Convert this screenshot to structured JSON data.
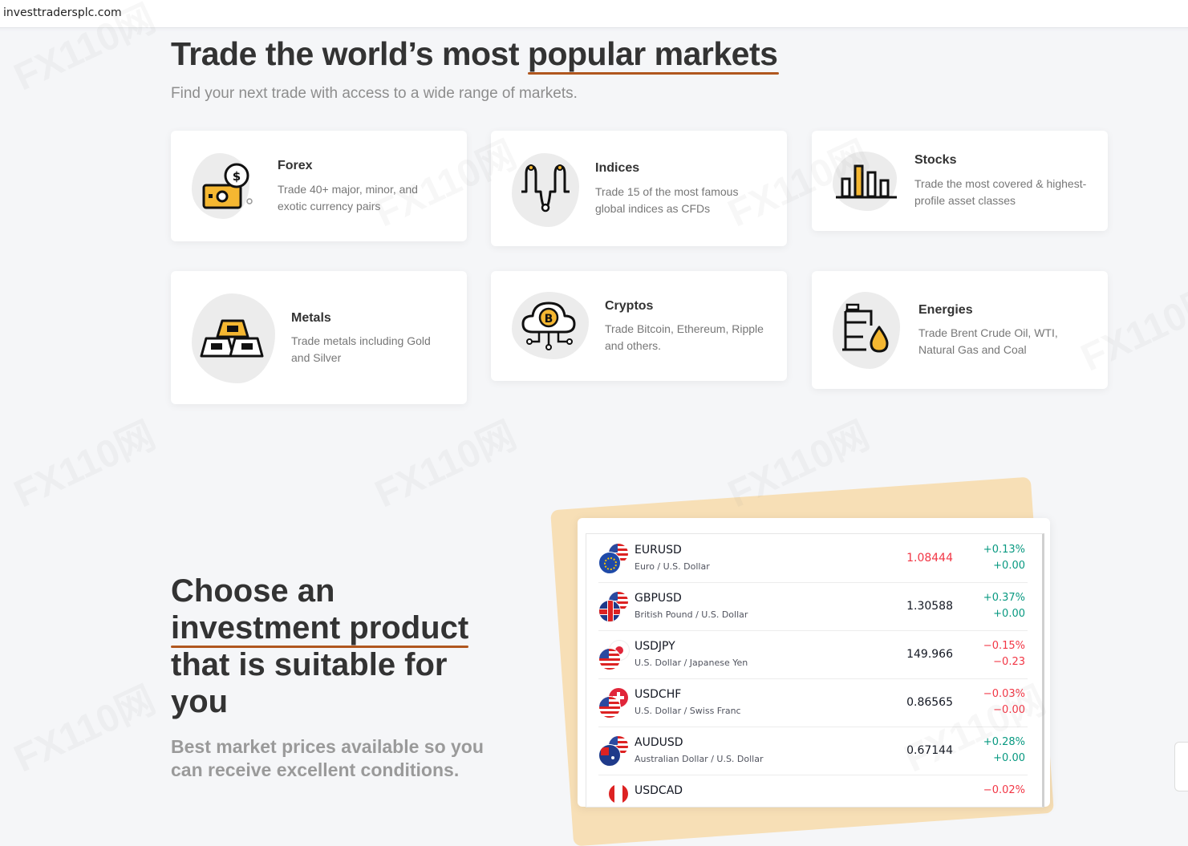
{
  "browser": {
    "url": "investtradersplc.com"
  },
  "hero": {
    "title_lead": "Trade the world’s most ",
    "title_highlight": "popular markets",
    "subtitle": "Find your next trade with access to a wide range of markets."
  },
  "markets": [
    {
      "title": "Forex",
      "desc": "Trade 40+ major, minor, and exotic currency pairs",
      "icon": "money-bill-dollar-icon"
    },
    {
      "title": "Indices",
      "desc": "Trade 15 of the most famous global indices as CFDs",
      "icon": "signal-wave-icon"
    },
    {
      "title": "Stocks",
      "desc": "Trade the most covered & highest-profile asset classes",
      "icon": "bar-chart-icon"
    },
    {
      "title": "Metals",
      "desc": "Trade metals including Gold and Silver",
      "icon": "gold-bars-icon"
    },
    {
      "title": "Cryptos",
      "desc": "Trade Bitcoin, Ethereum, Ripple and others.",
      "icon": "bitcoin-cloud-icon"
    },
    {
      "title": "Energies",
      "desc": "Trade Brent Crude Oil, WTI, Natural Gas and Coal",
      "icon": "oil-barrel-icon"
    }
  ],
  "invest": {
    "title_l1": "Choose an",
    "title_l2": "investment product",
    "title_l3": "that is suitable for",
    "title_l4": "you",
    "subtitle": "Best market prices available so you can receive excellent conditions."
  },
  "colors": {
    "accent_underline": "#b0571f",
    "up": "#089981",
    "down": "#f23645",
    "widget_back": "#f7dfb6"
  },
  "quotes": [
    {
      "symbol": "EURUSD",
      "name": "Euro / U.S. Dollar",
      "price": "1.08444",
      "price_color": "down",
      "change_pct": "+0.13%",
      "change": "+0.00",
      "change_color": "up"
    },
    {
      "symbol": "GBPUSD",
      "name": "British Pound / U.S. Dollar",
      "price": "1.30588",
      "price_color": "neutral",
      "change_pct": "+0.37%",
      "change": "+0.00",
      "change_color": "up"
    },
    {
      "symbol": "USDJPY",
      "name": "U.S. Dollar / Japanese Yen",
      "price": "149.966",
      "price_color": "neutral",
      "change_pct": "−0.15%",
      "change": "−0.23",
      "change_color": "down"
    },
    {
      "symbol": "USDCHF",
      "name": "U.S. Dollar / Swiss Franc",
      "price": "0.86565",
      "price_color": "neutral",
      "change_pct": "−0.03%",
      "change": "−0.00",
      "change_color": "down"
    },
    {
      "symbol": "AUDUSD",
      "name": "Australian Dollar / U.S. Dollar",
      "price": "0.67144",
      "price_color": "neutral",
      "change_pct": "+0.28%",
      "change": "+0.00",
      "change_color": "up"
    },
    {
      "symbol": "USDCAD",
      "name": "",
      "price": "",
      "price_color": "neutral",
      "change_pct": "−0.02%",
      "change": "",
      "change_color": "down"
    }
  ],
  "watermark": {
    "text": "FX110网"
  }
}
